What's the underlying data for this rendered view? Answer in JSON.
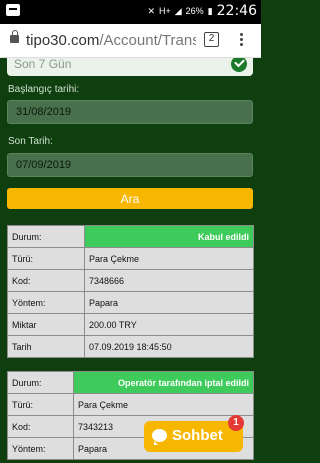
{
  "status_bar": {
    "battery": "26%",
    "time": "22:46",
    "network": "H+"
  },
  "browser": {
    "url_host": "tipo30.com",
    "url_path": "/Account/Transac",
    "tab_count": "2"
  },
  "filter": {
    "period_value": "Son 7 Gün",
    "start_label": "Başlangıç tarihi:",
    "start_value": "31/08/2019",
    "end_label": "Son Tarih:",
    "end_value": "07/09/2019",
    "search_label": "Ara"
  },
  "transactions": [
    {
      "status_label": "Durum:",
      "status": "Kabul edildi",
      "type_label": "Türü:",
      "type": "Para Çekme",
      "code_label": "Kod:",
      "code": "7348666",
      "method_label": "Yöntem:",
      "method": "Papara",
      "amount_label": "Miktar",
      "amount": "200.00 TRY",
      "date_label": "Tarih",
      "date": "07.09.2019 18:45:50"
    },
    {
      "status_label": "Durum:",
      "status": "Operatör tarafından iptal edildi",
      "type_label": "Türü:",
      "type": "Para Çekme",
      "code_label": "Kod:",
      "code": "7343213",
      "method_label": "Yöntem:",
      "method": "Papara"
    }
  ],
  "chat": {
    "label": "Sohbet",
    "badge": "1"
  },
  "colors": {
    "background": "#0f3f0f",
    "accent": "#f7b600",
    "success": "#3ecb5b",
    "danger": "#e53935"
  }
}
